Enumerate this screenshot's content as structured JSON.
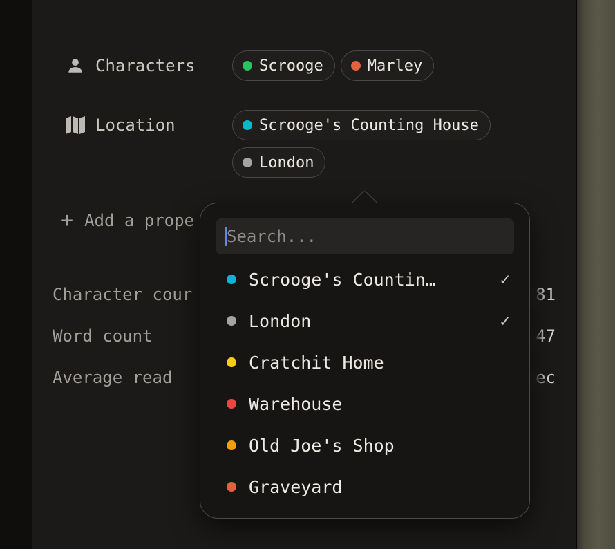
{
  "properties": {
    "characters": {
      "label": "Characters",
      "icon": "person-icon",
      "chips": [
        {
          "label": "Scrooge",
          "color": "#22c55e"
        },
        {
          "label": "Marley",
          "color": "#e0623f"
        }
      ]
    },
    "location": {
      "label": "Location",
      "icon": "map-icon",
      "chips": [
        {
          "label": "Scrooge's Counting House",
          "color": "#06b6d4"
        },
        {
          "label": "London",
          "color": "#a3a3a3"
        }
      ]
    }
  },
  "add_property": {
    "label": "Add a prope",
    "icon": "plus-icon"
  },
  "stats": [
    {
      "label": "Character cour",
      "value": "81"
    },
    {
      "label": "Word count",
      "value": "47"
    },
    {
      "label": "Average read",
      "value": "ec"
    }
  ],
  "dropdown": {
    "search_placeholder": "Search...",
    "options": [
      {
        "label": "Scrooge's Countin…",
        "color": "#06b6d4",
        "checked": true
      },
      {
        "label": "London",
        "color": "#a3a3a3",
        "checked": true
      },
      {
        "label": "Cratchit Home",
        "color": "#facc15",
        "checked": false
      },
      {
        "label": "Warehouse",
        "color": "#ef4444",
        "checked": false
      },
      {
        "label": "Old Joe's Shop",
        "color": "#f59e0b",
        "checked": false
      },
      {
        "label": "Graveyard",
        "color": "#e0623f",
        "checked": false
      }
    ],
    "check_glyph": "✓"
  }
}
